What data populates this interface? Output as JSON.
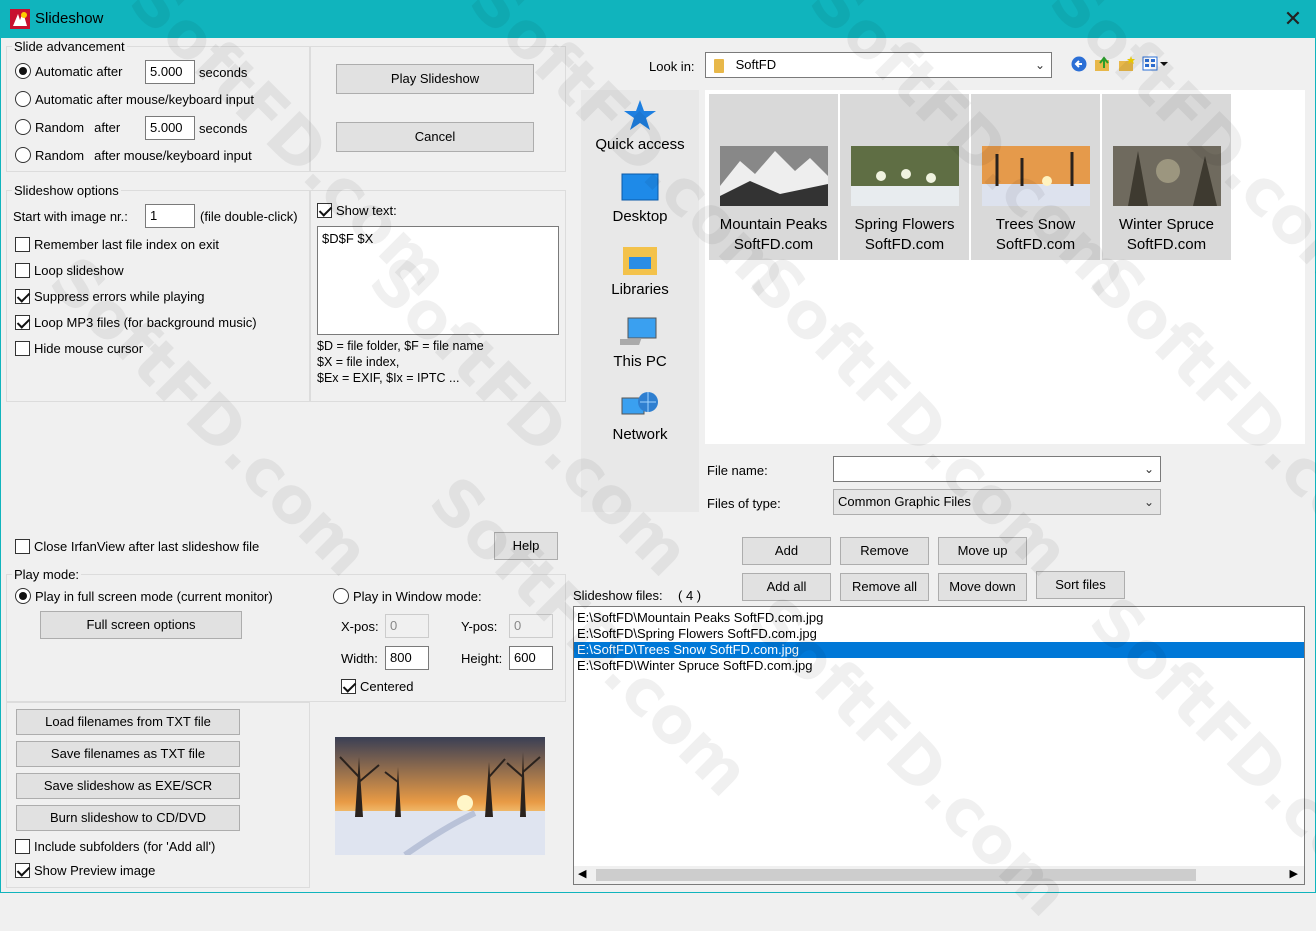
{
  "window": {
    "title": "Slideshow",
    "close_glyph": "✕"
  },
  "slide_advancement": {
    "label": "Slide advancement",
    "auto_after_label": "Automatic after",
    "auto_after_value": "5.000",
    "seconds_label": "seconds",
    "auto_mouse_label": "Automatic after mouse/keyboard input",
    "random_label": "Random",
    "after_label": "after",
    "random_after_value": "5.000",
    "random_mouse_after": "after mouse/keyboard input"
  },
  "buttons": {
    "play_slideshow": "Play Slideshow",
    "cancel": "Cancel",
    "help": "Help",
    "full_screen_options": "Full screen options",
    "load_txt": "Load filenames from TXT file",
    "save_txt": "Save filenames as TXT file",
    "save_exe": "Save slideshow as  EXE/SCR",
    "burn_cd": "Burn slideshow to CD/DVD",
    "add": "Add",
    "remove": "Remove",
    "move_up": "Move up",
    "add_all": "Add all",
    "remove_all": "Remove all",
    "move_down": "Move down",
    "sort_files": "Sort files"
  },
  "slideshow_options": {
    "label": "Slideshow options",
    "start_with_label": "Start with image nr.:",
    "start_with_value": "1",
    "file_dblclick": "(file double-click)",
    "remember_last": "Remember last file index on exit",
    "loop_slideshow": "Loop slideshow",
    "suppress_errors": "Suppress errors while playing",
    "loop_mp3": "Loop MP3 files (for background music)",
    "hide_cursor": "Hide mouse cursor",
    "show_text": "Show text:",
    "text_value": "$D$F $X",
    "help_line1": "$D = file folder, $F = file name",
    "help_line2": "$X = file index,",
    "help_line3": "$Ex = EXIF, $Ix = IPTC ..."
  },
  "close_irfan": "Close IrfanView after last slideshow file",
  "play_mode": {
    "label": "Play mode:",
    "full_screen": "Play in full screen mode (current monitor)",
    "window_mode": "Play in Window mode:",
    "xpos_label": "X-pos:",
    "xpos_value": "0",
    "ypos_label": "Y-pos:",
    "ypos_value": "0",
    "width_label": "Width:",
    "width_value": "800",
    "height_label": "Height:",
    "height_value": "600",
    "centered": "Centered"
  },
  "include_subfolders": "Include subfolders (for 'Add all')",
  "show_preview": "Show Preview image",
  "file_browser": {
    "look_in_label": "Look in:",
    "look_in_value": "SoftFD",
    "places": [
      "Quick access",
      "Desktop",
      "Libraries",
      "This PC",
      "Network"
    ],
    "thumbs": [
      {
        "line1": "Mountain Peaks",
        "line2": "SoftFD.com"
      },
      {
        "line1": "Spring Flowers",
        "line2": "SoftFD.com"
      },
      {
        "line1": "Trees Snow",
        "line2": "SoftFD.com"
      },
      {
        "line1": "Winter Spruce",
        "line2": "SoftFD.com"
      }
    ],
    "file_name_label": "File name:",
    "file_name_value": "",
    "files_of_type_label": "Files of type:",
    "files_of_type_value": "Common Graphic Files"
  },
  "slideshow_files": {
    "label": "Slideshow files:",
    "count": "( 4 )",
    "items": [
      "E:\\SoftFD\\Mountain Peaks SoftFD.com.jpg",
      "E:\\SoftFD\\Spring Flowers SoftFD.com.jpg",
      "E:\\SoftFD\\Trees Snow SoftFD.com.jpg",
      "E:\\SoftFD\\Winter Spruce SoftFD.com.jpg"
    ],
    "selected_index": 2
  },
  "watermark": "SoftFD.com",
  "colors": {
    "titlebar": "#10b4bd",
    "selection": "#0078d7"
  }
}
